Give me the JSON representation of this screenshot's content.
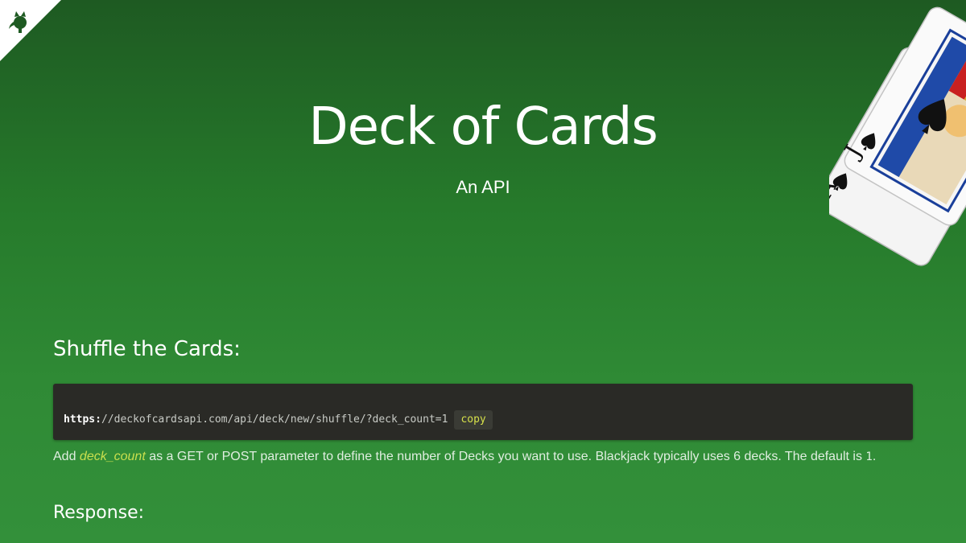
{
  "header": {
    "title": "Deck of Cards",
    "subtitle": "An API"
  },
  "github_corner": {
    "icon": "octocat-icon",
    "background": "#ffffff",
    "color": "#1e5a22"
  },
  "decoration": {
    "cards": [
      "jack-of-spades",
      "ace-of-spades"
    ]
  },
  "shuffle_section": {
    "title": "Shuffle the Cards:",
    "url_protocol": "https:",
    "url_rest": "//deckofcardsapi.com/api/deck/new/shuffle/?deck_count=1",
    "copy_label": "copy",
    "desc_part1": "Add ",
    "param_name": "deck_count",
    "desc_part2": " as a GET or POST parameter to define the number of Decks you want to use. Blackjack typically uses 6 decks. The default is ",
    "default_value": "1",
    "desc_end": "."
  },
  "response_section": {
    "title": "Response:"
  },
  "colors": {
    "background_top": "#1e5a22",
    "background_bottom": "#33903a",
    "code_background": "#2a2a26",
    "accent": "#c9df4e"
  }
}
